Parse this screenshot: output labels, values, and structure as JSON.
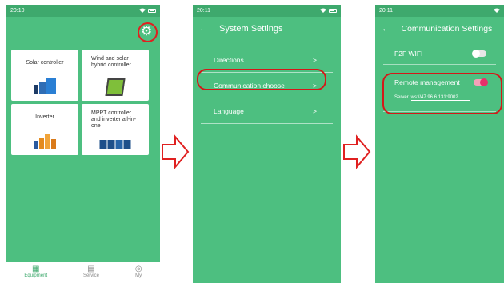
{
  "phone1": {
    "status_time": "20:10",
    "cards": [
      {
        "label": "Solar controller"
      },
      {
        "label": "Wind and solar hybrid controller"
      },
      {
        "label": "Inverter"
      },
      {
        "label": "MPPT controller and inverter all-in-one"
      }
    ],
    "tabs": [
      {
        "label": "Equipment",
        "icon": "grid-icon"
      },
      {
        "label": "Service",
        "icon": "service-icon"
      },
      {
        "label": "My",
        "icon": "user-icon"
      }
    ]
  },
  "phone2": {
    "status_time": "20:11",
    "title": "System Settings",
    "items": [
      {
        "label": "Directions",
        "chevron": ">"
      },
      {
        "label": "Communication choose",
        "chevron": ">"
      },
      {
        "label": "Language",
        "chevron": ">"
      }
    ]
  },
  "phone3": {
    "status_time": "20:11",
    "title": "Communication Settings",
    "f2f_label": "F2F WIFI",
    "remote_label": "Remote management",
    "server_label": "Server",
    "server_value": "ws://47.96.6.131:9002"
  },
  "colors": {
    "screen_bg": "#4dbf80",
    "status_bg": "#3ea96d",
    "highlight": "#e02020",
    "toggle_on": "#e8306a"
  }
}
